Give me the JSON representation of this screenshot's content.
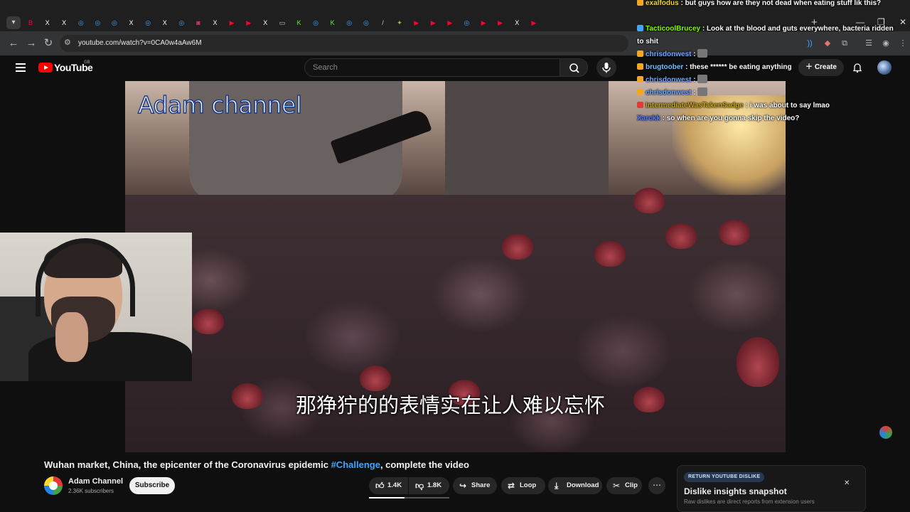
{
  "browser": {
    "tabs": [
      {
        "icon": "youtube-icon",
        "color": "#ff0033",
        "glyph": "B"
      },
      {
        "icon": "x-icon",
        "color": "#ffffff",
        "glyph": "X"
      },
      {
        "icon": "x-icon",
        "color": "#ffffff",
        "glyph": "X"
      },
      {
        "icon": "globe-icon",
        "color": "#3ea6ff",
        "glyph": "◎"
      },
      {
        "icon": "globe-icon",
        "color": "#3ea6ff",
        "glyph": "◎"
      },
      {
        "icon": "globe-icon",
        "color": "#3ea6ff",
        "glyph": "◎"
      },
      {
        "icon": "x-icon",
        "color": "#ffffff",
        "glyph": "X"
      },
      {
        "icon": "globe-icon",
        "color": "#3ea6ff",
        "glyph": "◎"
      },
      {
        "icon": "x-icon",
        "color": "#ffffff",
        "glyph": "X"
      },
      {
        "icon": "globe-icon",
        "color": "#3ea6ff",
        "glyph": "◎"
      },
      {
        "icon": "instagram-icon",
        "color": "#e1306c",
        "glyph": "◙"
      },
      {
        "icon": "x-icon",
        "color": "#ffffff",
        "glyph": "X"
      },
      {
        "icon": "youtube-icon",
        "color": "#ff0033",
        "glyph": "▶"
      },
      {
        "icon": "youtube-icon",
        "color": "#ff0033",
        "glyph": "▶"
      },
      {
        "icon": "x-icon",
        "color": "#ffffff",
        "glyph": "X"
      },
      {
        "icon": "window-icon",
        "color": "#cccccc",
        "glyph": "▭"
      },
      {
        "icon": "kick-icon",
        "color": "#53fc18",
        "glyph": "K"
      },
      {
        "icon": "globe-icon",
        "color": "#3ea6ff",
        "glyph": "◎"
      },
      {
        "icon": "kick-icon",
        "color": "#53fc18",
        "glyph": "K"
      },
      {
        "icon": "globe-icon",
        "color": "#3ea6ff",
        "glyph": "◎"
      },
      {
        "icon": "globe-icon",
        "color": "#3ea6ff",
        "glyph": "◎"
      },
      {
        "icon": "slash-icon",
        "color": "#cccccc",
        "glyph": "/"
      },
      {
        "icon": "leaf-icon",
        "color": "#8bc34a",
        "glyph": "✦"
      },
      {
        "icon": "youtube-icon",
        "color": "#ff0033",
        "glyph": "▶"
      },
      {
        "icon": "youtube-icon",
        "color": "#ff0033",
        "glyph": "▶"
      },
      {
        "icon": "youtube-icon",
        "color": "#ff0033",
        "glyph": "▶"
      },
      {
        "icon": "globe-icon",
        "color": "#3ea6ff",
        "glyph": "◎"
      },
      {
        "icon": "youtube-icon",
        "color": "#ff0033",
        "glyph": "▶"
      },
      {
        "icon": "youtube-icon",
        "color": "#ff0033",
        "glyph": "▶"
      },
      {
        "icon": "x-icon",
        "color": "#ffffff",
        "glyph": "X"
      },
      {
        "icon": "youtube-icon",
        "color": "#ff0033",
        "glyph": "▶"
      }
    ],
    "url": "youtube.com/watch?v=0CA0w4aAw6M"
  },
  "youtube": {
    "logo_text": "YouTube",
    "region": "GB",
    "search_placeholder": "Search",
    "create_label": "Create"
  },
  "video": {
    "watermark": "Adam channel",
    "subtitle": "那狰狞的的表情实在让人难以忘怀",
    "title_main": "Wuhan market, China, the epicenter of the Coronavirus epidemic ",
    "title_tag": "#Challenge",
    "title_tail": ", complete the video",
    "channel_name": "Adam Channel",
    "subscribers": "2.36K subscribers",
    "subscribe_label": "Subscribe",
    "like_count": "1.4K",
    "dislike_count": "1.8K",
    "like_fraction": 0.44,
    "share_label": "Share",
    "loop_label": "Loop",
    "download_label": "Download",
    "clip_label": "Clip"
  },
  "chat": [
    {
      "user": "exalfodus",
      "color": "#f5d142",
      "text": "but guys how are they not dead when eating stuff lik this?",
      "badge": "#f5a623",
      "emote": false
    },
    {
      "user": "TacticoolBrucey",
      "color": "#7fff00",
      "text": "Look at the blood and guts everywhere, bacteria ridden to shit",
      "badge": "#3ea6ff",
      "emote": false
    },
    {
      "user": "chrisdonwest",
      "color": "#6fa8ff",
      "text": "",
      "badge": "#f5a623",
      "emote": true
    },
    {
      "user": "brugtoober",
      "color": "#6fc1ff",
      "text": "these ****** be eating anything",
      "badge": "#f5a623",
      "emote": false
    },
    {
      "user": "chrisdonwest",
      "color": "#6fa8ff",
      "text": "",
      "badge": "#f5a623",
      "emote": true
    },
    {
      "user": "chrisdonwest",
      "color": "#6fa8ff",
      "text": "",
      "badge": "#f5a623",
      "emote": true
    },
    {
      "user": "IntermediateWasTakenSadge",
      "color": "#c9a227",
      "text": "i was about to say lmao",
      "badge": "#e53935",
      "emote": false
    },
    {
      "user": "Xarckk",
      "color": "#4f7dff",
      "text": "so when are you gonna skip the video?",
      "badge": "",
      "emote": false
    }
  ],
  "return_dislike": {
    "badge": "RETURN YOUTUBE DISLIKE",
    "title": "Dislike insights snapshot",
    "text": "Raw dislikes are direct reports from extension users"
  }
}
